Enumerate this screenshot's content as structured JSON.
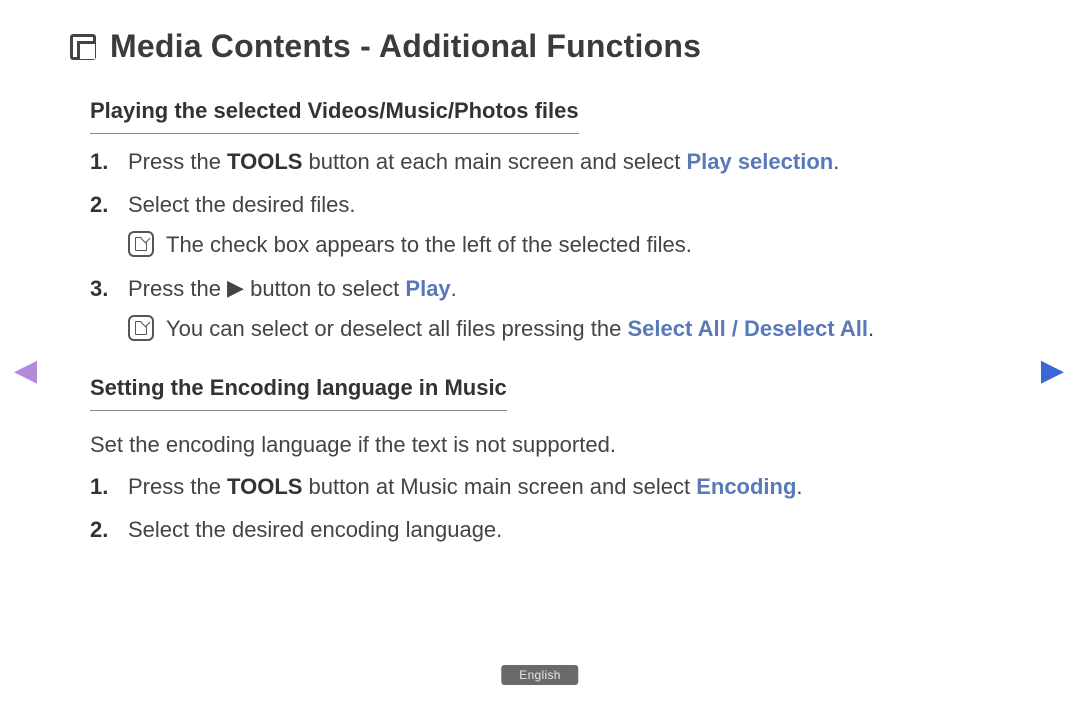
{
  "title": "Media Contents - Additional Functions",
  "section1": {
    "heading": "Playing the selected Videos/Music/Photos files",
    "step1_a": "Press the ",
    "step1_b": "TOOLS",
    "step1_c": " button at each main screen and select ",
    "step1_d": "Play selection",
    "step1_e": ".",
    "step2": "Select the desired files.",
    "note1": "The check box appears to the left of the selected files.",
    "step3_a": "Press the ",
    "step3_tri": "▶",
    "step3_b": " button to select ",
    "step3_c": "Play",
    "step3_d": ".",
    "note2_a": "You can select or deselect all files pressing the ",
    "note2_b": "Select All / Deselect All",
    "note2_c": "."
  },
  "section2": {
    "heading": "Setting the Encoding language in Music",
    "intro": "Set the encoding language if the text is not supported.",
    "step1_a": "Press the ",
    "step1_b": "TOOLS",
    "step1_c": " button at Music main screen and select ",
    "step1_d": "Encoding",
    "step1_e": ".",
    "step2": "Select the desired encoding language."
  },
  "nav": {
    "prev_glyph": "◀",
    "next_glyph": "▶"
  },
  "language_badge": "English"
}
